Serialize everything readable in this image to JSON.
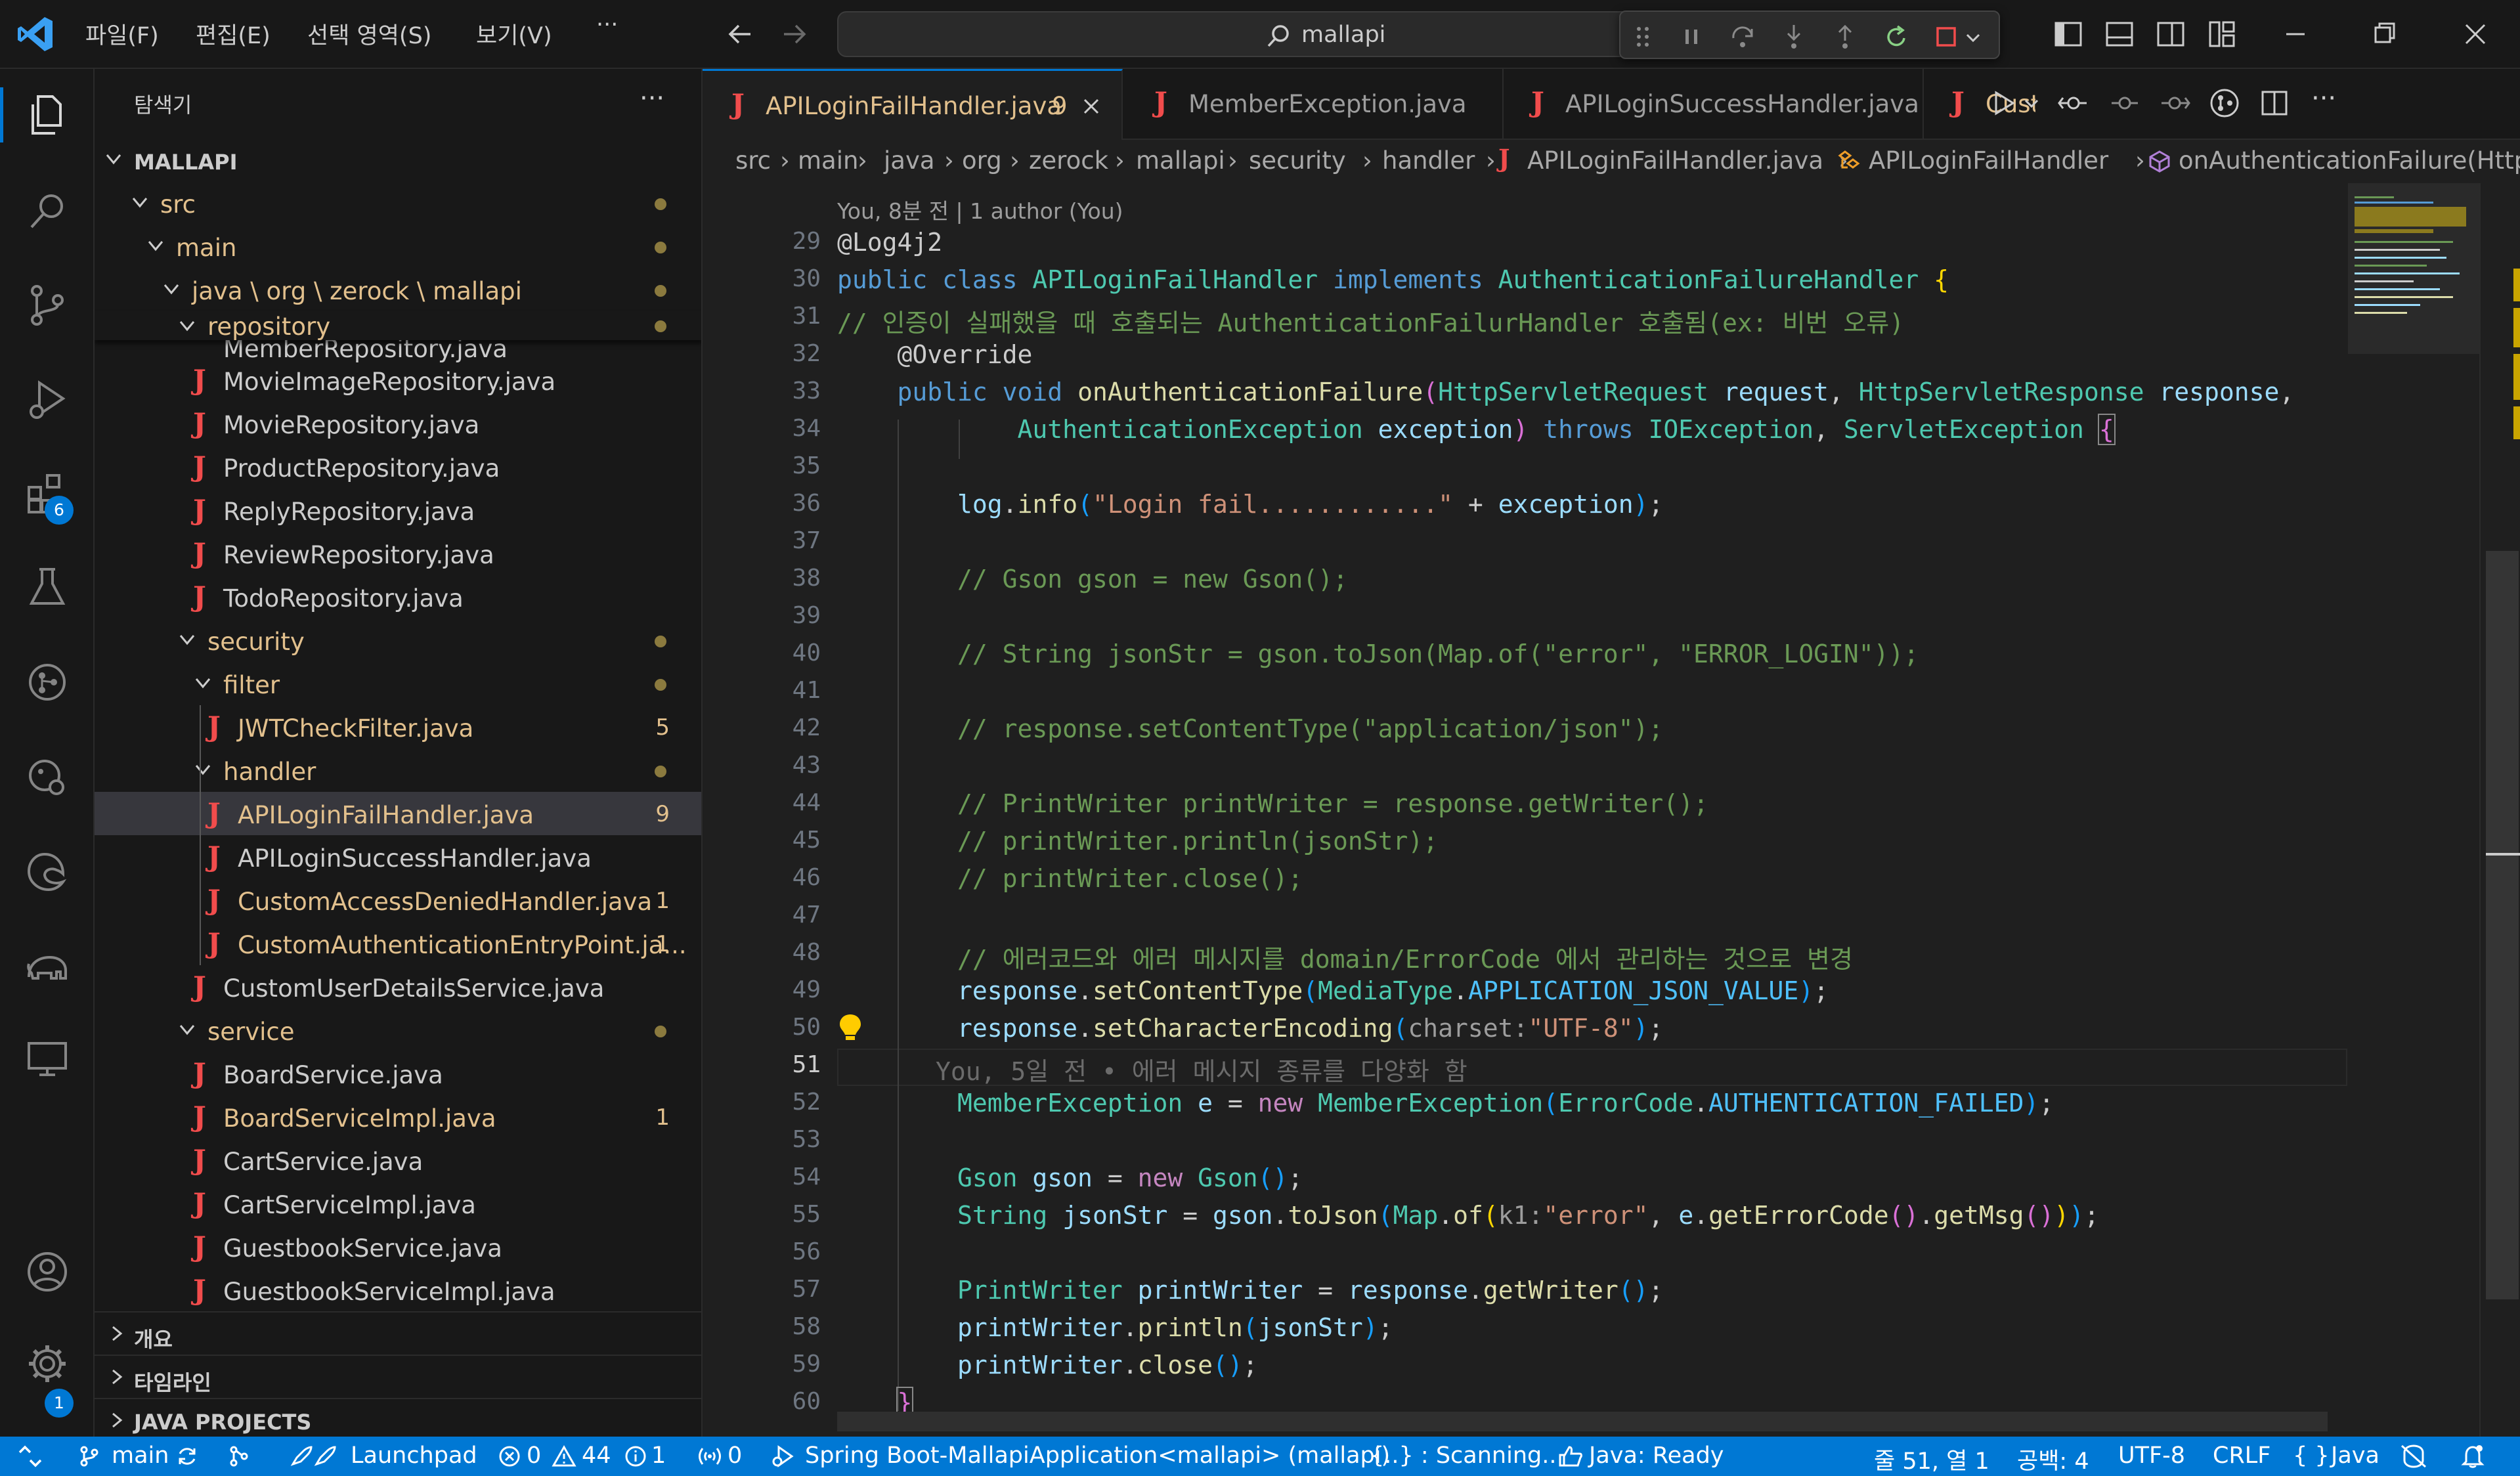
{
  "titlebar": {
    "menus": [
      "파일(F)",
      "편집(E)",
      "선택 영역(S)",
      "보기(V)",
      "···"
    ],
    "command_center": "mallapi"
  },
  "activity_bar": {
    "extensions_badge": "6",
    "settings_badge": "1"
  },
  "sidebar": {
    "title": "탐색기",
    "root": "MALLAPI",
    "partial_top": "MemberRepository.java",
    "partial_bottom": "GuestbookServiceImpl.java",
    "tree": [
      {
        "label": "src",
        "type": "dir"
      },
      {
        "label": "main",
        "type": "dir"
      },
      {
        "label": "java \\ org \\ zerock \\ mallapi",
        "type": "dir"
      },
      {
        "label": "repository",
        "type": "dir"
      },
      {
        "label": "MovieImageRepository.java",
        "type": "file"
      },
      {
        "label": "MovieRepository.java",
        "type": "file"
      },
      {
        "label": "ProductRepository.java",
        "type": "file"
      },
      {
        "label": "ReplyRepository.java",
        "type": "file"
      },
      {
        "label": "ReviewRepository.java",
        "type": "file"
      },
      {
        "label": "TodoRepository.java",
        "type": "file"
      },
      {
        "label": "security",
        "type": "dir"
      },
      {
        "label": "filter",
        "type": "dir"
      },
      {
        "label": "JWTCheckFilter.java",
        "type": "file",
        "badge": "5"
      },
      {
        "label": "handler",
        "type": "dir"
      },
      {
        "label": "APILoginFailHandler.java",
        "type": "file",
        "badge": "9"
      },
      {
        "label": "APILoginSuccessHandler.java",
        "type": "file"
      },
      {
        "label": "CustomAccessDeniedHandler.java",
        "type": "file",
        "badge": "1"
      },
      {
        "label": "CustomAuthenticationEntryPoint.ja...",
        "type": "file",
        "badge": "1"
      },
      {
        "label": "CustomUserDetailsService.java",
        "type": "file"
      },
      {
        "label": "service",
        "type": "dir"
      },
      {
        "label": "BoardService.java",
        "type": "file"
      },
      {
        "label": "BoardServiceImpl.java",
        "type": "file",
        "badge": "1"
      },
      {
        "label": "CartService.java",
        "type": "file"
      },
      {
        "label": "CartServiceImpl.java",
        "type": "file"
      },
      {
        "label": "GuestbookService.java",
        "type": "file"
      }
    ],
    "sections": [
      "개요",
      "타임라인",
      "JAVA PROJECTS"
    ]
  },
  "tabs": [
    {
      "label": "APILoginFailHandler.java",
      "badge": "9"
    },
    {
      "label": "MemberException.java"
    },
    {
      "label": "APILoginSuccessHandler.java"
    },
    {
      "label": "CustomA"
    }
  ],
  "breadcrumbs": [
    "src",
    "main",
    "java",
    "org",
    "zerock",
    "mallapi",
    "security",
    "handler",
    "APILoginFailHandler.java",
    "APILoginFailHandler",
    "onAuthenticationFailure(HttpSe"
  ],
  "editor": {
    "codelens": "You, 8분 전 | 1 author (You)",
    "line_numbers": [
      "29",
      "30",
      "31",
      "32",
      "33",
      "34",
      "35",
      "36",
      "37",
      "38",
      "39",
      "40",
      "41",
      "42",
      "43",
      "44",
      "45",
      "46",
      "47",
      "48",
      "49",
      "50",
      "51",
      "52",
      "53",
      "54",
      "55",
      "56",
      "57",
      "58",
      "59",
      "60"
    ],
    "lines": {
      "l29": "@Log4j2",
      "l30_kw": "public class ",
      "l30_cls": "APILoginFailHandler",
      "l30_impl": " implements ",
      "l30_if": "AuthenticationFailureHandler",
      "l30_br": " {",
      "l31": "// 인증이 실패했을 때 호출되는 AuthenticationFailurHandler 호출됨(ex: 비번 오류)",
      "l32": "@Override",
      "l33_kw": "public void ",
      "l33_fn": "onAuthenticationFailure",
      "l33_p1t": "HttpServletRequest",
      "l33_p1": " request",
      "l33_p2t": "HttpServletResponse",
      "l33_p2": " response",
      "l34_t": "AuthenticationException",
      "l34_v": " exception",
      "l34_throws": " throws ",
      "l34_e1": "IOException",
      "l34_e2": "ServletException",
      "l36_obj": "log",
      "l36_fn": "info",
      "l36_str": "\"Login fail............\"",
      "l36_var": "exception",
      "l38": "// Gson gson = new Gson();",
      "l40": "// String jsonStr = gson.toJson(Map.of(\"error\", \"ERROR_LOGIN\"));",
      "l42": "// response.setContentType(\"application/json\");",
      "l44": "// PrintWriter printWriter = response.getWriter();",
      "l45": "// printWriter.println(jsonStr);",
      "l46": "// printWriter.close();",
      "l48": "// 에러코드와 에러 메시지를 domain/ErrorCode 에서 관리하는 것으로 변경",
      "l49_obj": "response",
      "l49_fn": "setContentType",
      "l49_cls": "MediaType",
      "l49_const": "APPLICATION_JSON_VALUE",
      "l50_obj": "response",
      "l50_fn": "setCharacterEncoding",
      "l50_hint": "charset:",
      "l50_str": "\"UTF-8\"",
      "l51_blame": "You, 5일 전 • 에러 메시지 종류를 다양화 함",
      "l52_t": "MemberException",
      "l52_v": " e",
      "l52_new": "new ",
      "l52_ctor": "MemberException",
      "l52_cls": "ErrorCode",
      "l52_const": "AUTHENTICATION_FAILED",
      "l54_t": "Gson",
      "l54_v": " gson",
      "l54_new": "new ",
      "l54_ctor": "Gson",
      "l55_t": "String",
      "l55_v": " jsonStr",
      "l55_obj": "gson",
      "l55_fn": "toJson",
      "l55_map": "Map",
      "l55_of": "of",
      "l55_hint": "k1:",
      "l55_str": "\"error\"",
      "l55_e": "e",
      "l55_get": "getErrorCode",
      "l55_msg": "getMsg",
      "l57_t": "PrintWriter",
      "l57_v": " printWriter",
      "l57_obj": "response",
      "l57_fn": "getWriter",
      "l58_obj": "printWriter",
      "l58_fn": "println",
      "l58_arg": "jsonStr",
      "l59_obj": "printWriter",
      "l59_fn": "close",
      "l60": "}"
    }
  },
  "statusbar": {
    "branch": "main",
    "launchpad": "Launchpad",
    "errors": "0",
    "warnings": "44",
    "infos": "1",
    "ports": "0",
    "run_config": "Spring Boot-MallapiApplication<mallapi> (mallapi)",
    "scanning": "{..} : Scanning..",
    "java_status": "Java: Ready",
    "position": "줄 51, 열 1",
    "spaces": "공백: 4",
    "encoding": "UTF-8",
    "eol": "CRLF",
    "language": "Java"
  },
  "colors": {
    "accent": "#0078d4",
    "modified": "#e2c08d",
    "java_icon": "#f14c4c"
  }
}
